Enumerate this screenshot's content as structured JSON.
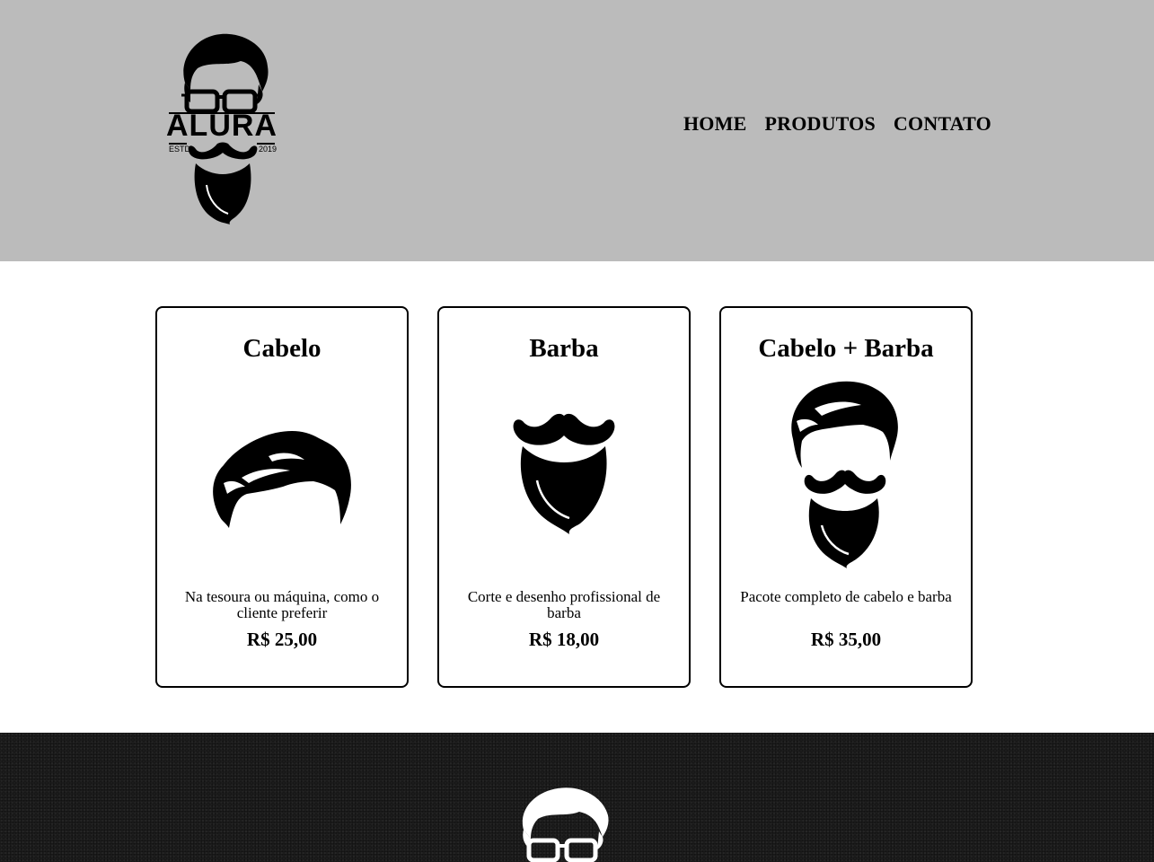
{
  "header": {
    "logo": {
      "icon": "bearded-man-with-glasses-logo",
      "brand": "ALURA",
      "estd": "ESTD",
      "year": "2019"
    },
    "nav": [
      {
        "label": "HOME"
      },
      {
        "label": "PRODUTOS"
      },
      {
        "label": "CONTATO"
      }
    ],
    "background": "#bbbbbb"
  },
  "products": [
    {
      "title": "Cabelo",
      "icon": "hair-icon",
      "description": "Na tesoura ou máquina, como o cliente preferir",
      "price": "R$ 25,00"
    },
    {
      "title": "Barba",
      "icon": "beard-icon",
      "description": "Corte e desenho profissional de barba",
      "price": "R$ 18,00"
    },
    {
      "title": "Cabelo + Barba",
      "icon": "hair-and-beard-icon",
      "description": "Pacote completo de cabelo e barba",
      "price": "R$ 35,00"
    }
  ],
  "footer": {
    "logo_icon": "white-bearded-man-logo",
    "background": "#1c1c1c"
  }
}
